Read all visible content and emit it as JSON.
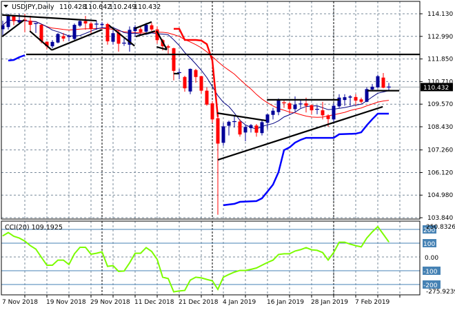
{
  "header": {
    "symbol": "USDJPY,Daily",
    "open": "110.428",
    "high": "110.642",
    "low": "110.249",
    "close": "110.432",
    "menu_icon": "triangle-down-icon"
  },
  "colors": {
    "bull": "#000099",
    "bear": "#ff0000",
    "ma_fast": "#000080",
    "ma_slow": "#ff0000",
    "thick_blue": "#0000ff",
    "thick_red": "#ff0000",
    "cci": "#7cfc00",
    "cci_levels": "#4682b4",
    "grid": "#778899",
    "trendline": "#000000"
  },
  "chart_data": [
    {
      "type": "candlestick",
      "title": "USDJPY,Daily",
      "price_ticks": [
        "114.130",
        "112.990",
        "111.850",
        "110.710",
        "109.570",
        "108.430",
        "107.260",
        "106.120",
        "104.980",
        "103.840"
      ],
      "price_tick_values": [
        114.13,
        112.99,
        111.85,
        110.71,
        109.57,
        108.43,
        107.26,
        106.12,
        104.98,
        103.84
      ],
      "current_price_label": "110.432",
      "current_price": 110.432,
      "ylim": [
        103.84,
        114.13
      ],
      "x_labels": [
        {
          "bar": 0,
          "label": "7 Nov 2018"
        },
        {
          "bar": 8,
          "label": "19 Nov 2018"
        },
        {
          "bar": 16,
          "label": "29 Nov 2018"
        },
        {
          "bar": 24,
          "label": "11 Dec 2018"
        },
        {
          "bar": 32,
          "label": "21 Dec 2018"
        },
        {
          "bar": 40,
          "label": "4 Jan 2019"
        },
        {
          "bar": 48,
          "label": "16 Jan 2019"
        },
        {
          "bar": 56,
          "label": "28 Jan 2019"
        },
        {
          "bar": 64,
          "label": "7 Feb 2019"
        }
      ],
      "month_separators_bars": [
        18,
        38,
        60
      ],
      "ohlc": [
        [
          113.35,
          113.78,
          112.98,
          113.55
        ],
        [
          113.46,
          114.13,
          113.33,
          114.07
        ],
        [
          114.04,
          114.07,
          113.55,
          113.76
        ],
        [
          113.69,
          114.13,
          113.61,
          113.78
        ],
        [
          113.81,
          114.13,
          113.2,
          113.76
        ],
        [
          113.78,
          114.03,
          113.2,
          113.57
        ],
        [
          113.6,
          113.68,
          113.16,
          113.64
        ],
        [
          113.57,
          113.61,
          112.64,
          112.74
        ],
        [
          112.72,
          112.74,
          112.33,
          112.49
        ],
        [
          112.49,
          112.8,
          112.39,
          112.71
        ],
        [
          112.68,
          113.16,
          112.64,
          113.11
        ],
        [
          113.0,
          113.16,
          112.74,
          112.88
        ],
        [
          112.95,
          113.09,
          112.74,
          112.98
        ],
        [
          112.86,
          113.64,
          112.81,
          113.57
        ],
        [
          113.53,
          113.81,
          113.46,
          113.76
        ],
        [
          113.76,
          114.02,
          113.32,
          113.64
        ],
        [
          113.64,
          113.72,
          113.15,
          113.38
        ],
        [
          113.58,
          113.78,
          113.32,
          113.61
        ],
        [
          113.56,
          113.72,
          113.4,
          113.62
        ],
        [
          113.61,
          113.67,
          112.57,
          112.74
        ],
        [
          112.72,
          113.32,
          112.57,
          113.15
        ],
        [
          113.18,
          113.32,
          112.22,
          112.62
        ],
        [
          112.63,
          112.91,
          112.51,
          112.65
        ],
        [
          112.57,
          113.49,
          112.22,
          113.32
        ],
        [
          113.26,
          113.55,
          112.97,
          113.46
        ],
        [
          113.35,
          113.49,
          113.03,
          113.2
        ],
        [
          113.23,
          113.67,
          113.15,
          113.57
        ],
        [
          113.55,
          113.67,
          113.26,
          113.34
        ],
        [
          113.34,
          113.49,
          112.62,
          112.8
        ],
        [
          112.8,
          112.86,
          112.28,
          112.49
        ],
        [
          112.49,
          112.57,
          112.1,
          112.42
        ],
        [
          112.39,
          112.42,
          110.77,
          111.25
        ],
        [
          111.14,
          111.35,
          110.83,
          111.16
        ],
        [
          110.94,
          111.0,
          110.2,
          110.37
        ],
        [
          110.21,
          111.37,
          110.07,
          111.35
        ],
        [
          111.29,
          111.35,
          110.65,
          110.94
        ],
        [
          110.98,
          111.0,
          110.1,
          110.25
        ],
        [
          110.25,
          110.42,
          109.49,
          109.55
        ],
        [
          109.61,
          109.73,
          108.63,
          108.8
        ],
        [
          108.86,
          108.92,
          103.99,
          107.58
        ],
        [
          107.62,
          108.63,
          107.47,
          108.45
        ],
        [
          108.48,
          108.74,
          107.99,
          108.68
        ],
        [
          108.67,
          109.03,
          108.39,
          108.69
        ],
        [
          108.69,
          108.8,
          107.93,
          108.04
        ],
        [
          108.14,
          108.51,
          107.7,
          108.42
        ],
        [
          108.36,
          108.57,
          108.14,
          108.51
        ],
        [
          108.49,
          108.57,
          107.93,
          108.13
        ],
        [
          108.11,
          108.8,
          107.99,
          108.66
        ],
        [
          108.63,
          109.09,
          108.28,
          109.05
        ],
        [
          109.03,
          109.38,
          108.8,
          109.24
        ],
        [
          109.17,
          109.86,
          109.01,
          109.78
        ],
        [
          109.64,
          109.78,
          109.38,
          109.61
        ],
        [
          109.61,
          109.68,
          109.09,
          109.32
        ],
        [
          109.32,
          109.96,
          109.2,
          109.55
        ],
        [
          109.55,
          109.78,
          109.38,
          109.58
        ],
        [
          109.61,
          109.9,
          109.15,
          109.49
        ],
        [
          109.52,
          109.55,
          109.06,
          109.26
        ],
        [
          109.27,
          109.49,
          109.06,
          109.31
        ],
        [
          109.26,
          109.69,
          108.8,
          109.01
        ],
        [
          109.0,
          109.06,
          108.43,
          108.82
        ],
        [
          108.8,
          109.61,
          108.63,
          109.49
        ],
        [
          109.46,
          110.07,
          109.38,
          109.9
        ],
        [
          109.78,
          110.07,
          109.49,
          109.92
        ],
        [
          109.9,
          110.03,
          109.49,
          109.96
        ],
        [
          109.93,
          110.07,
          109.52,
          109.75
        ],
        [
          109.81,
          109.9,
          109.61,
          109.69
        ],
        [
          109.69,
          110.42,
          109.67,
          110.33
        ],
        [
          110.31,
          110.59,
          110.25,
          110.45
        ],
        [
          110.42,
          111.06,
          110.37,
          110.98
        ],
        [
          110.91,
          111.14,
          110.37,
          110.4
        ],
        [
          110.428,
          110.642,
          110.249,
          110.432
        ]
      ],
      "ma_fast_period": 8,
      "ma_slow_period": 20,
      "thick_red_line": [
        [
          31,
          113.37
        ],
        [
          32,
          113.37
        ],
        [
          33,
          112.81
        ],
        [
          34,
          112.81
        ],
        [
          35,
          112.81
        ],
        [
          36,
          112.78
        ],
        [
          37,
          112.6
        ],
        [
          38,
          111.77
        ],
        [
          39,
          108.92
        ]
      ],
      "thick_blue_line_segments": [
        [
          [
            1,
            111.77
          ],
          [
            2,
            111.8
          ],
          [
            3,
            111.94
          ],
          [
            4,
            112.04
          ]
        ],
        [
          [
            40,
            104.47
          ],
          [
            42,
            104.54
          ],
          [
            43,
            104.64
          ],
          [
            46,
            104.68
          ],
          [
            47,
            104.82
          ],
          [
            48,
            105.16
          ],
          [
            49,
            105.51
          ],
          [
            50,
            106.14
          ],
          [
            51,
            107.25
          ],
          [
            52,
            107.39
          ],
          [
            53,
            107.63
          ],
          [
            54,
            107.77
          ],
          [
            55,
            107.87
          ],
          [
            60,
            107.87
          ],
          [
            61,
            108.05
          ],
          [
            64,
            108.08
          ],
          [
            65,
            108.15
          ],
          [
            66,
            108.5
          ],
          [
            67,
            108.81
          ],
          [
            68,
            109.09
          ],
          [
            70,
            109.09
          ]
        ]
      ],
      "trendlines": [
        [
          [
            4.25,
            112.08
          ],
          [
            75.6,
            112.08
          ]
        ],
        [
          [
            -0.1,
            114.07
          ],
          [
            17,
            113.78
          ]
        ],
        [
          [
            -0.1,
            112.98
          ],
          [
            3.9,
            113.82
          ]
        ],
        [
          [
            4.9,
            113.26
          ],
          [
            8.9,
            112.3
          ]
        ],
        [
          [
            8.9,
            112.3
          ],
          [
            17.9,
            113.32
          ]
        ],
        [
          [
            19.25,
            113.55
          ],
          [
            23.9,
            112.51
          ]
        ],
        [
          [
            23.9,
            113.38
          ],
          [
            27,
            113.72
          ]
        ],
        [
          [
            24.1,
            112.98
          ],
          [
            27.6,
            113.26
          ]
        ],
        [
          [
            27.9,
            113.26
          ],
          [
            29.75,
            112.33
          ]
        ],
        [
          [
            27.9,
            112.46
          ],
          [
            29.75,
            112.32
          ]
        ],
        [
          [
            31,
            111.11
          ],
          [
            32,
            111.11
          ]
        ],
        [
          [
            38.9,
            109.12
          ],
          [
            47.75,
            108.74
          ]
        ],
        [
          [
            39,
            106.76
          ],
          [
            68.9,
            109.44
          ]
        ],
        [
          [
            47.9,
            109.79
          ],
          [
            61,
            109.79
          ]
        ],
        [
          [
            66.1,
            110.25
          ],
          [
            71.9,
            110.25
          ]
        ]
      ]
    },
    {
      "type": "line",
      "title": "CCI(20)",
      "label": "CCI(20) 109.1925",
      "ylim": [
        -275.9239,
        250.8326
      ],
      "max_label": "250.8326",
      "min_label": "-275.9239",
      "levels": [
        200,
        100,
        -100,
        -200
      ],
      "level_labels": [
        "200",
        "100",
        "-100",
        "-200"
      ],
      "zero_label": "0.00",
      "values": [
        153,
        177,
        150,
        137,
        115,
        82,
        57,
        -2,
        -60,
        -60,
        -23,
        -23,
        -55,
        23,
        70,
        70,
        20,
        27,
        37,
        -68,
        -63,
        -105,
        -102,
        -43,
        27,
        27,
        68,
        40,
        -18,
        -147,
        -157,
        -253,
        -247,
        -243,
        -168,
        -147,
        -152,
        -163,
        -173,
        -235,
        -147,
        -127,
        -110,
        -98,
        -98,
        -90,
        -80,
        -60,
        -40,
        -23,
        18,
        23,
        23,
        43,
        53,
        68,
        52,
        48,
        32,
        -22,
        32,
        107,
        107,
        93,
        82,
        73,
        137,
        182,
        220,
        165,
        109.1925
      ]
    }
  ]
}
